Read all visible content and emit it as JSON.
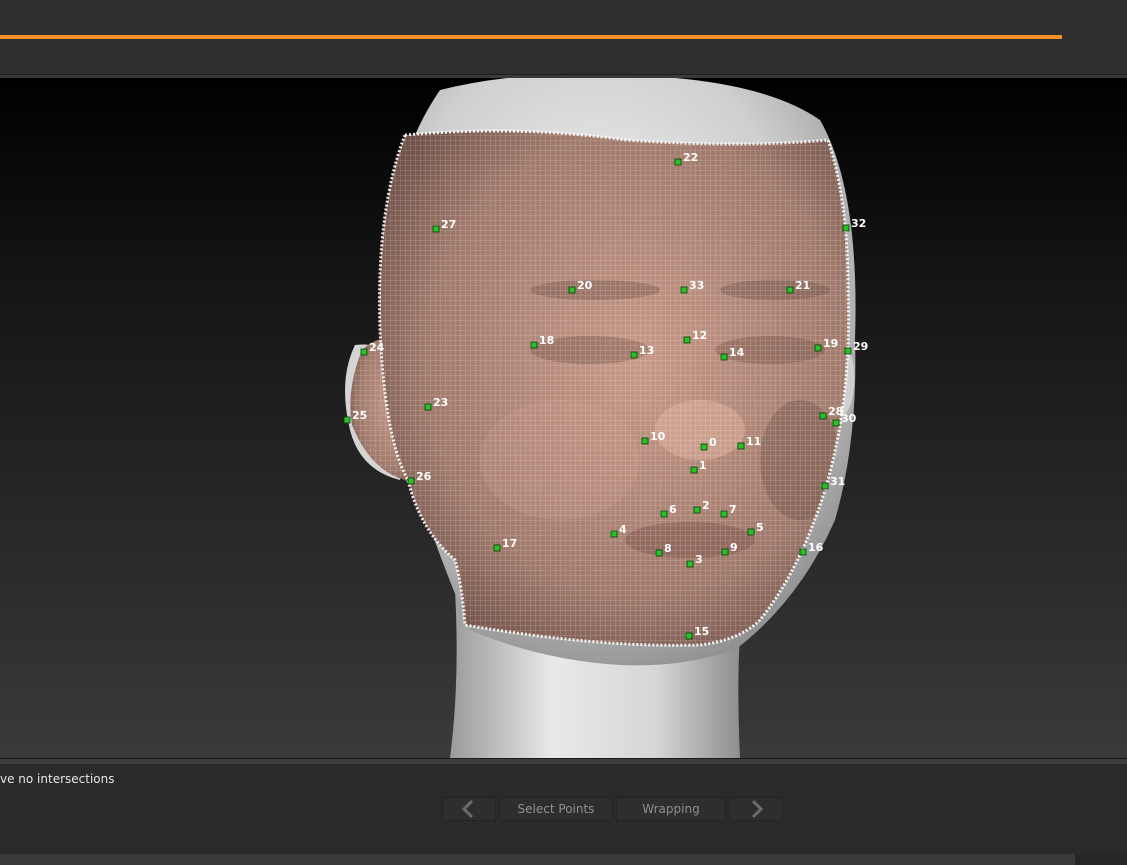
{
  "progress": {
    "fraction": 1.0,
    "color": "#f2902a"
  },
  "viewport": {
    "mesh_color": "#b08a7a",
    "wireframe_color": "#ffffff",
    "landmark_color": "#27c227",
    "landmarks": [
      {
        "id": "0",
        "label": "0"
      },
      {
        "id": "1",
        "label": "1"
      },
      {
        "id": "2",
        "label": "2"
      },
      {
        "id": "3",
        "label": "3"
      },
      {
        "id": "4",
        "label": "4"
      },
      {
        "id": "5",
        "label": "5"
      },
      {
        "id": "6",
        "label": "6"
      },
      {
        "id": "7",
        "label": "7"
      },
      {
        "id": "8",
        "label": "8"
      },
      {
        "id": "9",
        "label": "9"
      },
      {
        "id": "10",
        "label": "10"
      },
      {
        "id": "11",
        "label": "11"
      },
      {
        "id": "12",
        "label": "12"
      },
      {
        "id": "13",
        "label": "13"
      },
      {
        "id": "14",
        "label": "14"
      },
      {
        "id": "15",
        "label": "15"
      },
      {
        "id": "16",
        "label": "16"
      },
      {
        "id": "17",
        "label": "17"
      },
      {
        "id": "18",
        "label": "18"
      },
      {
        "id": "19",
        "label": "19"
      },
      {
        "id": "20",
        "label": "20"
      },
      {
        "id": "21",
        "label": "21"
      },
      {
        "id": "22",
        "label": "22"
      },
      {
        "id": "23",
        "label": "23"
      },
      {
        "id": "24",
        "label": "24"
      },
      {
        "id": "25",
        "label": "25"
      },
      {
        "id": "26",
        "label": "26"
      },
      {
        "id": "27",
        "label": "27"
      },
      {
        "id": "28",
        "label": "28"
      },
      {
        "id": "29",
        "label": "29"
      },
      {
        "id": "30",
        "label": "30"
      },
      {
        "id": "31",
        "label": "31"
      },
      {
        "id": "32",
        "label": "32"
      },
      {
        "id": "33",
        "label": "33"
      }
    ]
  },
  "status": {
    "message": "ve no intersections"
  },
  "nav": {
    "prev_icon": "chevron-left-icon",
    "next_icon": "chevron-right-icon",
    "steps": [
      "Select Points",
      "Wrapping"
    ]
  }
}
